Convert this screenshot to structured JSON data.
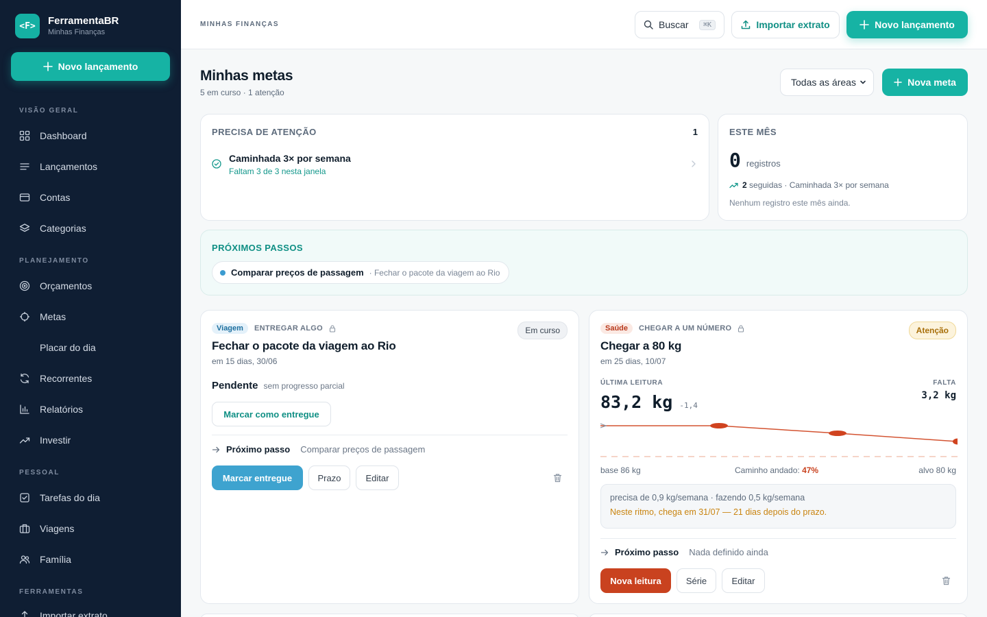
{
  "brand": {
    "logo": "<F>",
    "name": "FerramentaBR",
    "sub": "Minhas Finanças"
  },
  "sidebar": {
    "new_label": "Novo lançamento",
    "sections": [
      "VISÃO GERAL",
      "PLANEJAMENTO",
      "PESSOAL",
      "FERRAMENTAS"
    ],
    "items": [
      {
        "label": "Dashboard",
        "icon": "grid-icon"
      },
      {
        "label": "Lançamentos",
        "icon": "list-icon"
      },
      {
        "label": "Contas",
        "icon": "card-icon"
      },
      {
        "label": "Categorias",
        "icon": "layers-icon"
      },
      {
        "label": "Orçamentos",
        "icon": "target-icon"
      },
      {
        "label": "Metas",
        "icon": "crosshair-icon"
      },
      {
        "label": "Placar do dia",
        "icon": ""
      },
      {
        "label": "Recorrentes",
        "icon": "refresh-icon"
      },
      {
        "label": "Relatórios",
        "icon": "bar-chart-icon"
      },
      {
        "label": "Investir",
        "icon": "trend-icon"
      },
      {
        "label": "Tarefas do dia",
        "icon": "checkbox-icon"
      },
      {
        "label": "Viagens",
        "icon": "briefcase-icon"
      },
      {
        "label": "Família",
        "icon": "users-icon"
      },
      {
        "label": "Importar extrato",
        "icon": "upload-icon"
      }
    ]
  },
  "topbar": {
    "breadcrumb": "MINHAS FINANÇAS",
    "search_label": "Buscar",
    "search_kbd": "⌘K",
    "import_label": "Importar extrato",
    "new_label": "Novo lançamento"
  },
  "page": {
    "title": "Minhas metas",
    "subtitle": "5 em curso · 1 atenção",
    "filter_value": "Todas as áreas",
    "new_goal_label": "Nova meta"
  },
  "attention": {
    "heading": "PRECISA DE ATENÇÃO",
    "count": "1",
    "item_title": "Caminhada 3× por semana",
    "item_sub": "Faltam 3 de 3 nesta janela"
  },
  "month": {
    "heading": "ESTE MÊS",
    "count": "0",
    "count_label": "registros",
    "followed_num": "2",
    "followed_text": "seguidas · Caminhada 3× por semana",
    "empty": "Nenhum registro este mês ainda."
  },
  "next_steps": {
    "heading": "PRÓXIMOS PASSOS",
    "chip_title": "Comparar preços de passagem",
    "chip_sub": "· Fechar o pacote da viagem ao Rio"
  },
  "goal1": {
    "tag": "Viagem",
    "kind": "ENTREGAR ALGO",
    "status": "Em curso",
    "title": "Fechar o pacote da viagem ao Rio",
    "due": "em 15 dias, 30/06",
    "pending_label": "Pendente",
    "pending_sub": "sem progresso parcial",
    "mark_delivered": "Marcar como entregue",
    "next_label": "Próximo passo",
    "next_value": "Comparar preços de passagem",
    "btn_primary": "Marcar entregue",
    "btn_deadline": "Prazo",
    "btn_edit": "Editar"
  },
  "goal2": {
    "tag": "Saúde",
    "kind": "CHEGAR A UM NÚMERO",
    "status": "Atenção",
    "title": "Chegar a 80 kg",
    "due": "em 25 dias, 10/07",
    "last_label": "ÚLTIMA LEITURA",
    "last_value": "83,2 kg",
    "last_delta": "-1,4",
    "remaining_label": "FALTA",
    "remaining_value": "3,2 kg",
    "base_label": "base 86 kg",
    "walked_label": "Caminho andado:",
    "walked_value": "47%",
    "target_label": "alvo 80 kg",
    "pace_line1": "precisa de 0,9 kg/semana · fazendo 0,5 kg/semana",
    "pace_line2": "Neste ritmo, chega em 31/07 — 21 dias depois do prazo.",
    "next_label": "Próximo passo",
    "next_value": "Nada definido ainda",
    "btn_primary": "Nova leitura",
    "btn_series": "Série",
    "btn_edit": "Editar"
  },
  "colors": {
    "accent": "#16b3a4",
    "sidebar": "#0f1e33",
    "warn": "#c98410",
    "danger": "#c9421f",
    "info": "#3ea3cf"
  }
}
